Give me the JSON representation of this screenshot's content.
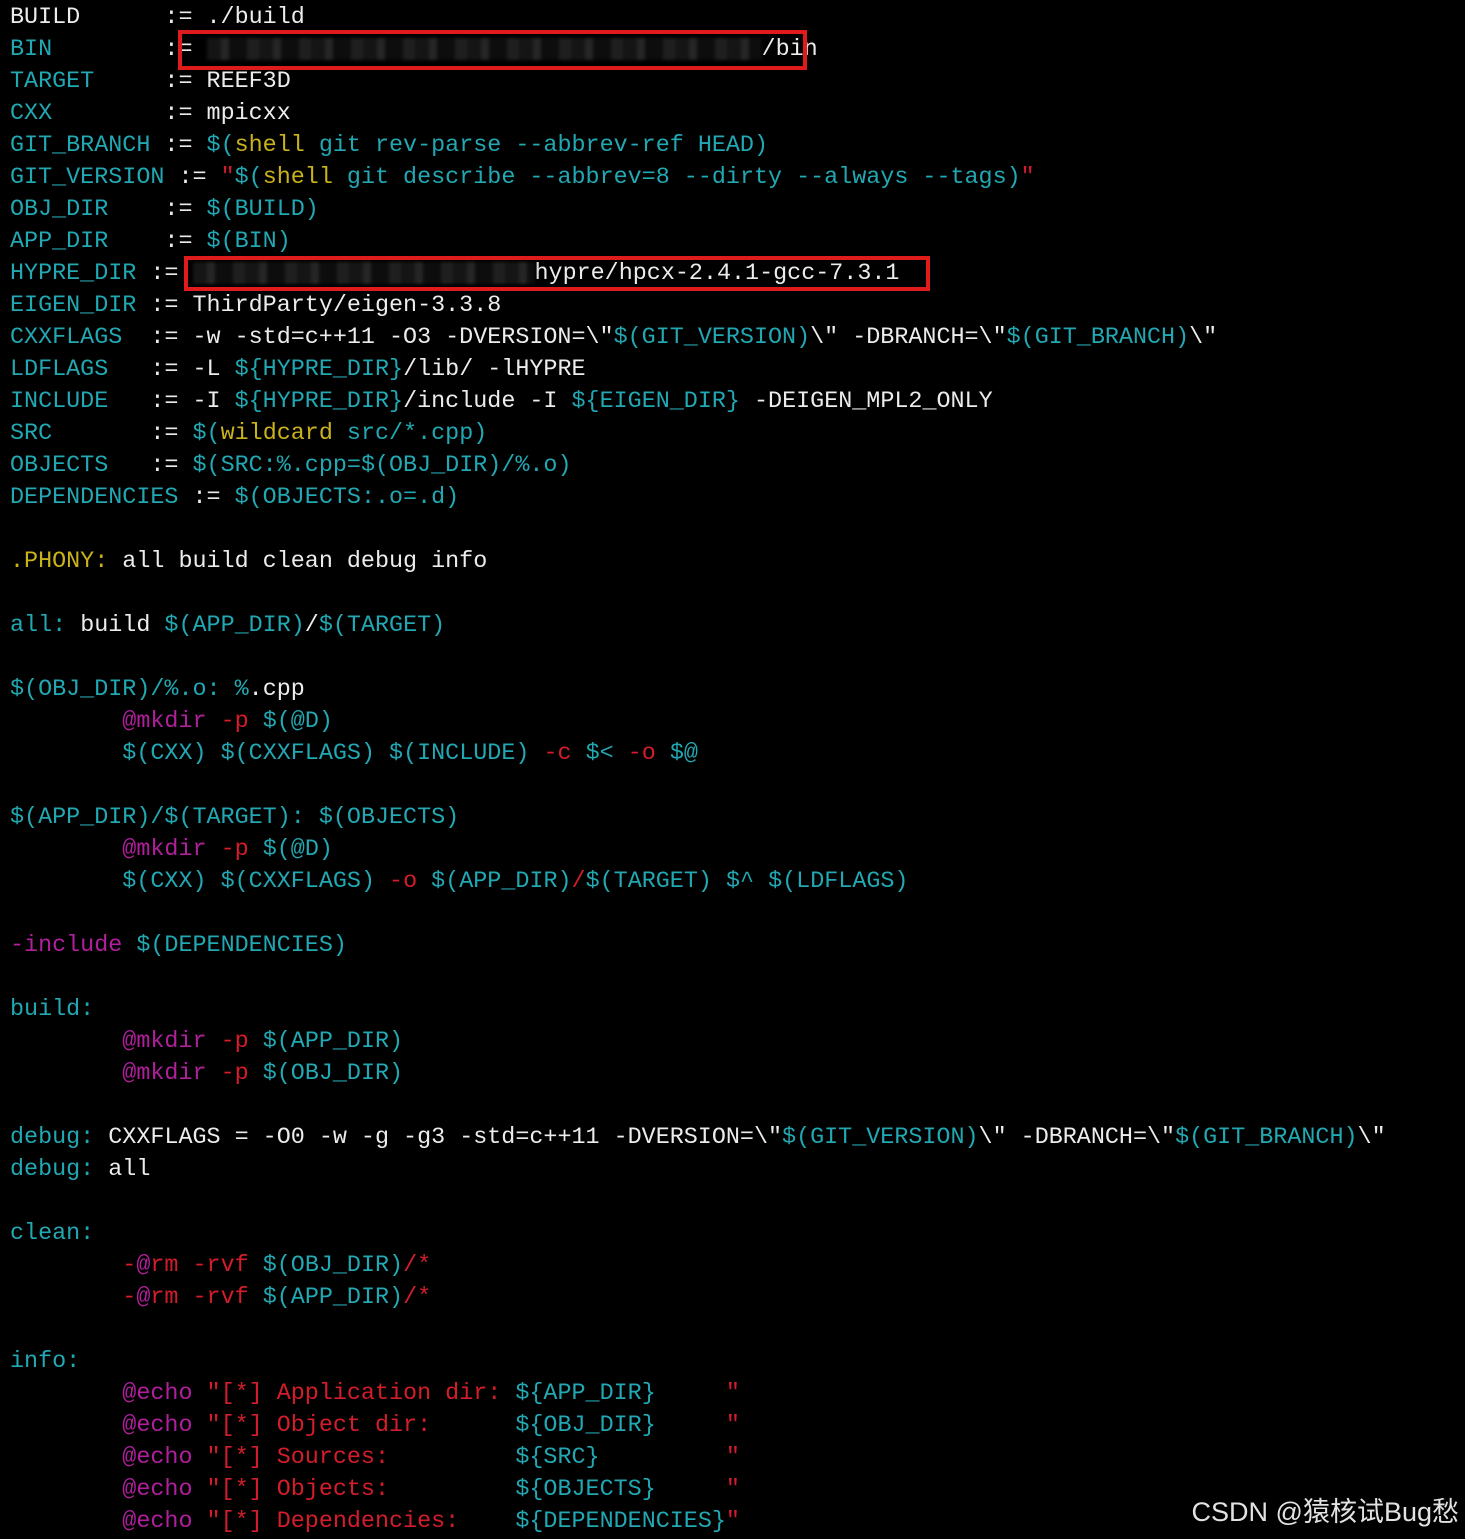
{
  "lines": [
    [
      [
        "n",
        "BUILD      := ./build"
      ]
    ],
    [
      [
        "var",
        "BIN"
      ],
      [
        "n",
        "        := "
      ],
      [
        "redact",
        "555"
      ],
      [
        "n",
        "/bin"
      ]
    ],
    [
      [
        "var",
        "TARGET"
      ],
      [
        "n",
        "     := REEF3D"
      ]
    ],
    [
      [
        "var",
        "CXX"
      ],
      [
        "n",
        "        := mpicxx"
      ]
    ],
    [
      [
        "var",
        "GIT_BRANCH"
      ],
      [
        "n",
        " := "
      ],
      [
        "var",
        "$("
      ],
      [
        "kw",
        "shell"
      ],
      [
        "var",
        " git rev-parse --abbrev-ref HEAD)"
      ]
    ],
    [
      [
        "var",
        "GIT_VERSION"
      ],
      [
        "n",
        " := "
      ],
      [
        "str",
        "\""
      ],
      [
        "var",
        "$("
      ],
      [
        "kw",
        "shell"
      ],
      [
        "var",
        " git describe --abbrev=8 --dirty --always --tags)"
      ],
      [
        "str",
        "\""
      ]
    ],
    [
      [
        "var",
        "OBJ_DIR"
      ],
      [
        "n",
        "    := "
      ],
      [
        "var",
        "$(BUILD)"
      ]
    ],
    [
      [
        "var",
        "APP_DIR"
      ],
      [
        "n",
        "    := "
      ],
      [
        "var",
        "$(BIN)"
      ]
    ],
    [
      [
        "var",
        "HYPRE_DIR"
      ],
      [
        "n",
        " := "
      ],
      [
        "redact",
        "342"
      ],
      [
        "n",
        "hypre/hpcx-2.4.1-gcc-7.3.1"
      ]
    ],
    [
      [
        "var",
        "EIGEN_DIR"
      ],
      [
        "n",
        " := ThirdParty/eigen-3.3.8"
      ]
    ],
    [
      [
        "var",
        "CXXFLAGS"
      ],
      [
        "n",
        "  := -w -std=c++11 -O3 -DVERSION=\\\""
      ],
      [
        "var",
        "$(GIT_VERSION)"
      ],
      [
        "n",
        "\\\" -DBRANCH=\\\""
      ],
      [
        "var",
        "$(GIT_BRANCH)"
      ],
      [
        "n",
        "\\\""
      ]
    ],
    [
      [
        "var",
        "LDFLAGS"
      ],
      [
        "n",
        "   := -L "
      ],
      [
        "var",
        "${HYPRE_DIR}"
      ],
      [
        "n",
        "/lib/ -lHYPRE"
      ]
    ],
    [
      [
        "var",
        "INCLUDE"
      ],
      [
        "n",
        "   := -I "
      ],
      [
        "var",
        "${HYPRE_DIR}"
      ],
      [
        "n",
        "/include -I "
      ],
      [
        "var",
        "${EIGEN_DIR}"
      ],
      [
        "n",
        " -DEIGEN_MPL2_ONLY"
      ]
    ],
    [
      [
        "var",
        "SRC"
      ],
      [
        "n",
        "       := "
      ],
      [
        "var",
        "$("
      ],
      [
        "kw",
        "wildcard"
      ],
      [
        "var",
        " src/*.cpp)"
      ]
    ],
    [
      [
        "var",
        "OBJECTS"
      ],
      [
        "n",
        "   := "
      ],
      [
        "var",
        "$(SRC:%.cpp=$(OBJ_DIR)/%.o)"
      ]
    ],
    [
      [
        "var",
        "DEPENDENCIES"
      ],
      [
        "n",
        " := "
      ],
      [
        "var",
        "$(OBJECTS:.o=.d)"
      ]
    ],
    [],
    [
      [
        "kw",
        ".PHONY:"
      ],
      [
        "n",
        " all build clean debug info"
      ]
    ],
    [],
    [
      [
        "var",
        "all:"
      ],
      [
        "n",
        " build "
      ],
      [
        "var",
        "$(APP_DIR)"
      ],
      [
        "n",
        "/"
      ],
      [
        "var",
        "$(TARGET)"
      ]
    ],
    [],
    [
      [
        "var",
        "$(OBJ_DIR)/%.o:"
      ],
      [
        "n",
        " "
      ],
      [
        "var",
        "%"
      ],
      [
        "n",
        ".cpp"
      ]
    ],
    [
      [
        "n",
        "        "
      ],
      [
        "at",
        "@mkdir"
      ],
      [
        "n",
        " "
      ],
      [
        "str",
        "-p"
      ],
      [
        "n",
        " "
      ],
      [
        "var",
        "$(@D)"
      ]
    ],
    [
      [
        "n",
        "        "
      ],
      [
        "var",
        "$(CXX)"
      ],
      [
        "n",
        " "
      ],
      [
        "var",
        "$(CXXFLAGS)"
      ],
      [
        "n",
        " "
      ],
      [
        "var",
        "$(INCLUDE)"
      ],
      [
        "n",
        " "
      ],
      [
        "str",
        "-c"
      ],
      [
        "n",
        " "
      ],
      [
        "var",
        "$<"
      ],
      [
        "n",
        " "
      ],
      [
        "str",
        "-o"
      ],
      [
        "n",
        " "
      ],
      [
        "var",
        "$@"
      ]
    ],
    [],
    [
      [
        "var",
        "$(APP_DIR)/$(TARGET):"
      ],
      [
        "n",
        " "
      ],
      [
        "var",
        "$(OBJECTS)"
      ]
    ],
    [
      [
        "n",
        "        "
      ],
      [
        "at",
        "@mkdir"
      ],
      [
        "n",
        " "
      ],
      [
        "str",
        "-p"
      ],
      [
        "n",
        " "
      ],
      [
        "var",
        "$(@D)"
      ]
    ],
    [
      [
        "n",
        "        "
      ],
      [
        "var",
        "$(CXX)"
      ],
      [
        "n",
        " "
      ],
      [
        "var",
        "$(CXXFLAGS)"
      ],
      [
        "n",
        " "
      ],
      [
        "str",
        "-o"
      ],
      [
        "n",
        " "
      ],
      [
        "var",
        "$(APP_DIR)"
      ],
      [
        "str",
        "/"
      ],
      [
        "var",
        "$(TARGET)"
      ],
      [
        "n",
        " "
      ],
      [
        "var",
        "$^"
      ],
      [
        "n",
        " "
      ],
      [
        "var",
        "$(LDFLAGS)"
      ]
    ],
    [],
    [
      [
        "at",
        "-include"
      ],
      [
        "n",
        " "
      ],
      [
        "var",
        "$(DEPENDENCIES)"
      ]
    ],
    [],
    [
      [
        "var",
        "build:"
      ]
    ],
    [
      [
        "n",
        "        "
      ],
      [
        "at",
        "@mkdir"
      ],
      [
        "n",
        " "
      ],
      [
        "str",
        "-p"
      ],
      [
        "n",
        " "
      ],
      [
        "var",
        "$(APP_DIR)"
      ]
    ],
    [
      [
        "n",
        "        "
      ],
      [
        "at",
        "@mkdir"
      ],
      [
        "n",
        " "
      ],
      [
        "str",
        "-p"
      ],
      [
        "n",
        " "
      ],
      [
        "var",
        "$(OBJ_DIR)"
      ]
    ],
    [],
    [
      [
        "var",
        "debug:"
      ],
      [
        "n",
        " CXXFLAGS = -O0 -w -g -g3 -std=c++11 -DVERSION=\\\""
      ],
      [
        "var",
        "$(GIT_VERSION)"
      ],
      [
        "n",
        "\\\" -DBRANCH=\\\""
      ],
      [
        "var",
        "$(GIT_BRANCH)"
      ],
      [
        "n",
        "\\\""
      ]
    ],
    [
      [
        "var",
        "debug:"
      ],
      [
        "n",
        " all"
      ]
    ],
    [],
    [
      [
        "var",
        "clean:"
      ]
    ],
    [
      [
        "n",
        "        "
      ],
      [
        "str",
        "-"
      ],
      [
        "at",
        "@"
      ],
      [
        "str",
        "rm -rvf"
      ],
      [
        "n",
        " "
      ],
      [
        "var",
        "$(OBJ_DIR)"
      ],
      [
        "str",
        "/*"
      ]
    ],
    [
      [
        "n",
        "        "
      ],
      [
        "str",
        "-"
      ],
      [
        "at",
        "@"
      ],
      [
        "str",
        "rm -rvf"
      ],
      [
        "n",
        " "
      ],
      [
        "var",
        "$(APP_DIR)"
      ],
      [
        "str",
        "/*"
      ]
    ],
    [],
    [
      [
        "var",
        "info:"
      ]
    ],
    [
      [
        "n",
        "        "
      ],
      [
        "at",
        "@echo"
      ],
      [
        "n",
        " "
      ],
      [
        "str",
        "\"[*] Application dir:"
      ],
      [
        "n",
        " "
      ],
      [
        "var",
        "${APP_DIR}"
      ],
      [
        "str",
        "     \""
      ]
    ],
    [
      [
        "n",
        "        "
      ],
      [
        "at",
        "@echo"
      ],
      [
        "n",
        " "
      ],
      [
        "str",
        "\"[*] Object dir:"
      ],
      [
        "n",
        "      "
      ],
      [
        "var",
        "${OBJ_DIR}"
      ],
      [
        "str",
        "     \""
      ]
    ],
    [
      [
        "n",
        "        "
      ],
      [
        "at",
        "@echo"
      ],
      [
        "n",
        " "
      ],
      [
        "str",
        "\"[*] Sources:"
      ],
      [
        "n",
        "         "
      ],
      [
        "var",
        "${SRC}"
      ],
      [
        "str",
        "         \""
      ]
    ],
    [
      [
        "n",
        "        "
      ],
      [
        "at",
        "@echo"
      ],
      [
        "n",
        " "
      ],
      [
        "str",
        "\"[*] Objects:"
      ],
      [
        "n",
        "         "
      ],
      [
        "var",
        "${OBJECTS}"
      ],
      [
        "str",
        "     \""
      ]
    ],
    [
      [
        "n",
        "        "
      ],
      [
        "at",
        "@echo"
      ],
      [
        "n",
        " "
      ],
      [
        "str",
        "\"[*] Dependencies:"
      ],
      [
        "n",
        "    "
      ],
      [
        "var",
        "${DEPENDENCIES}"
      ],
      [
        "str",
        "\""
      ]
    ]
  ],
  "watermark": "CSDN @猿核试Bug愁",
  "colors": {
    "background": "#000000",
    "default_text": "#ececec",
    "variable": "#22a8b3",
    "keyword": "#c9b21a",
    "string_flag": "#d31d2a",
    "at_command": "#b01f9c",
    "highlight_box": "#e01b1b"
  },
  "redacted_segments": [
    "bin-path-prefix",
    "hypre-path-prefix"
  ]
}
